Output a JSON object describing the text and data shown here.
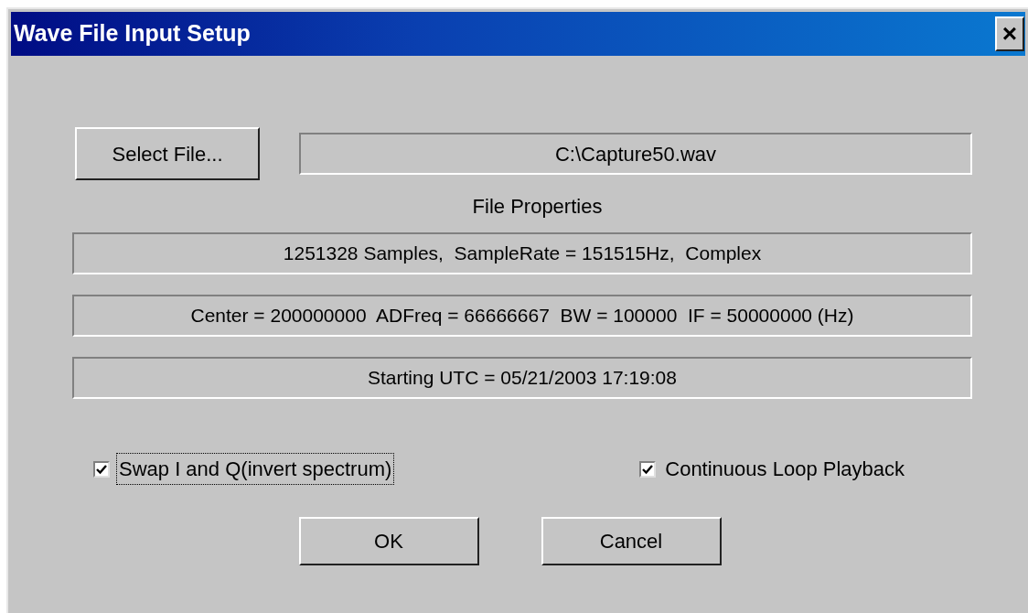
{
  "window": {
    "title": "Wave File Input Setup",
    "close_label": "×"
  },
  "select_file": {
    "button": "Select File...",
    "path": "C:\\Capture50.wav"
  },
  "properties_heading": "File Properties",
  "properties": [
    "1251328 Samples,  SampleRate = 151515Hz,  Complex",
    "Center = 200000000  ADFreq = 66666667  BW = 100000  IF = 50000000 (Hz)",
    "Starting UTC = 05/21/2003 17:19:08"
  ],
  "checkboxes": [
    {
      "label": "Swap I and Q(invert spectrum)",
      "checked": true,
      "focused": true
    },
    {
      "label": "Continuous Loop Playback",
      "checked": true,
      "focused": false
    }
  ],
  "buttons": [
    "OK",
    "Cancel"
  ]
}
